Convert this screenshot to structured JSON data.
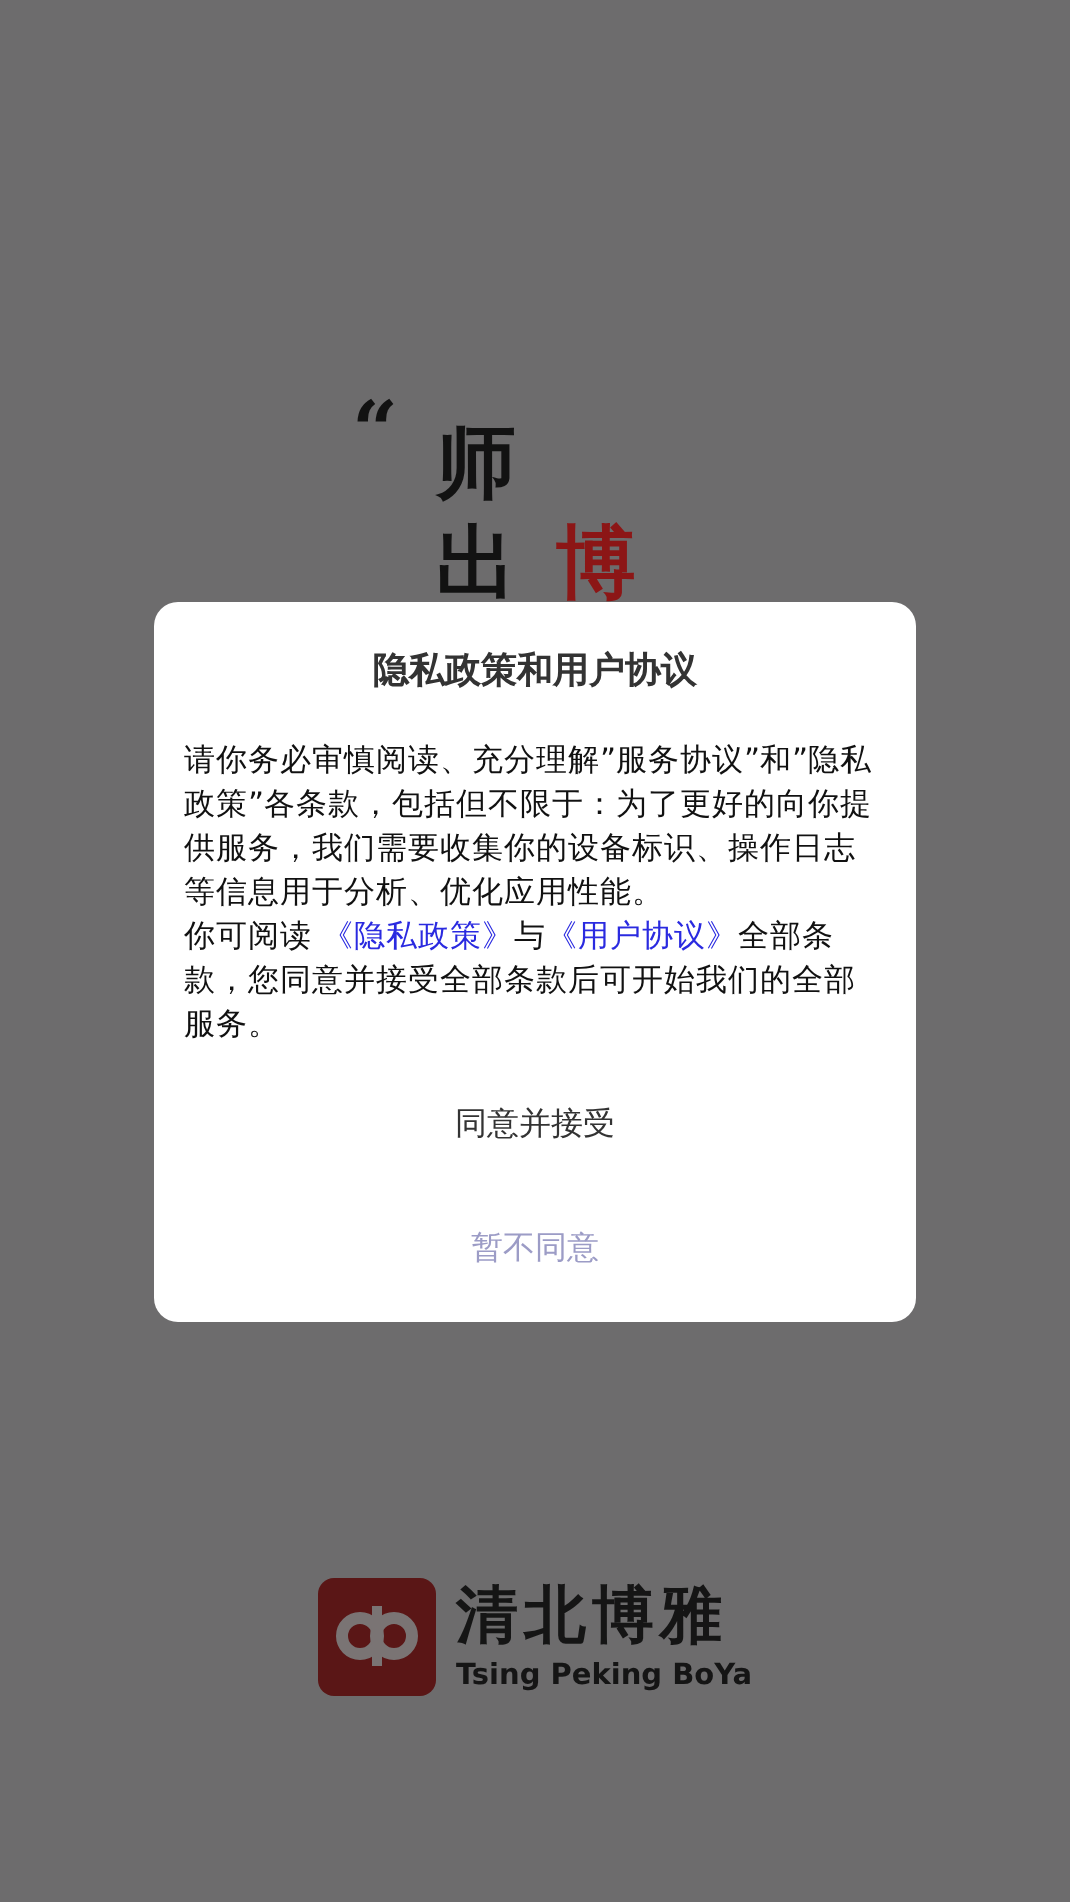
{
  "splash": {
    "slogan": [
      {
        "text": "“",
        "kind": "mark"
      },
      {
        "text": "师",
        "kind": "ink"
      },
      {
        "text": "出",
        "kind": "ink"
      },
      {
        "text": "博",
        "kind": "seal"
      }
    ],
    "brand": {
      "name": "清北博雅",
      "subtitle": "Tsing Peking BoYa"
    }
  },
  "dialog": {
    "title": "隐私政策和用户协议",
    "intro": "请你务必审慎阅读、充分理解”服务协议”和”隐私政策”各条款，包括但不限于：为了更好的向你提供服务，我们需要收集你的设备标识、操作日志等信息用于分析、优化应用性能。",
    "notice": [
      {
        "kind": "text",
        "text": "你可阅读 "
      },
      {
        "kind": "link",
        "text": "《隐私政策》"
      },
      {
        "kind": "text",
        "text": "与"
      },
      {
        "kind": "link",
        "text": "《用户协议》"
      },
      {
        "kind": "text",
        "text": "全部条款，您同意并接受全部条款后可开始我们的全部服务。"
      }
    ],
    "buttons": [
      {
        "label": "同意并接受",
        "kind": "primary"
      },
      {
        "label": "暂不同意",
        "kind": "secondary"
      }
    ]
  }
}
